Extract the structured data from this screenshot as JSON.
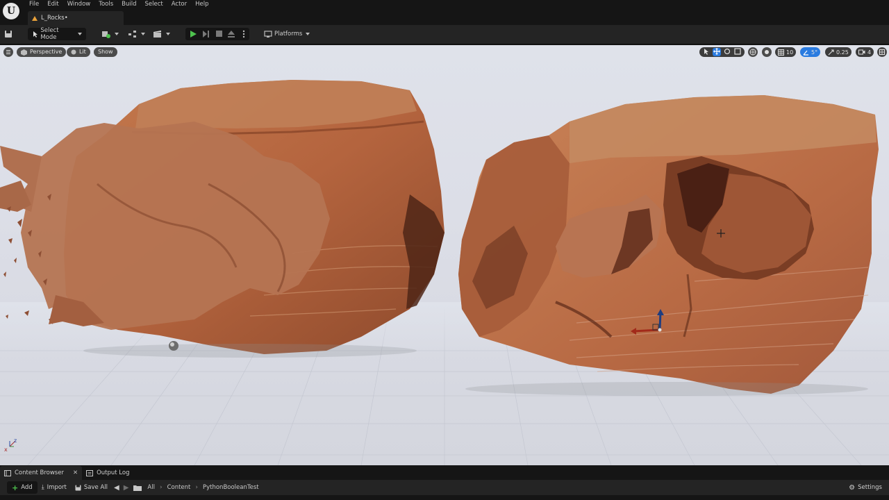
{
  "menu": [
    "File",
    "Edit",
    "Window",
    "Tools",
    "Build",
    "Select",
    "Actor",
    "Help"
  ],
  "doc_tab": "L_Rocks•",
  "toolbar": {
    "select_mode": "Select Mode",
    "platforms": "Platforms"
  },
  "viewport": {
    "perspective": "Perspective",
    "lit": "Lit",
    "show": "Show",
    "grid_snap": "10",
    "rotation_snap": "5°",
    "scale_snap": "0.25",
    "camera_speed": "4"
  },
  "content_browser": {
    "tabs": [
      "Content Browser",
      "Output Log"
    ],
    "add": "Add",
    "import": "Import",
    "save_all": "Save All",
    "breadcrumbs": [
      "All",
      "Content",
      "PythonBooleanTest"
    ],
    "settings": "Settings"
  },
  "colors": {
    "accent_blue": "#2a7be0",
    "play_green": "#4ec24e",
    "rock_main": "#b8673f",
    "rock_dark": "#6e3420",
    "editor_dark": "#151515",
    "editor_panel": "#242424"
  }
}
